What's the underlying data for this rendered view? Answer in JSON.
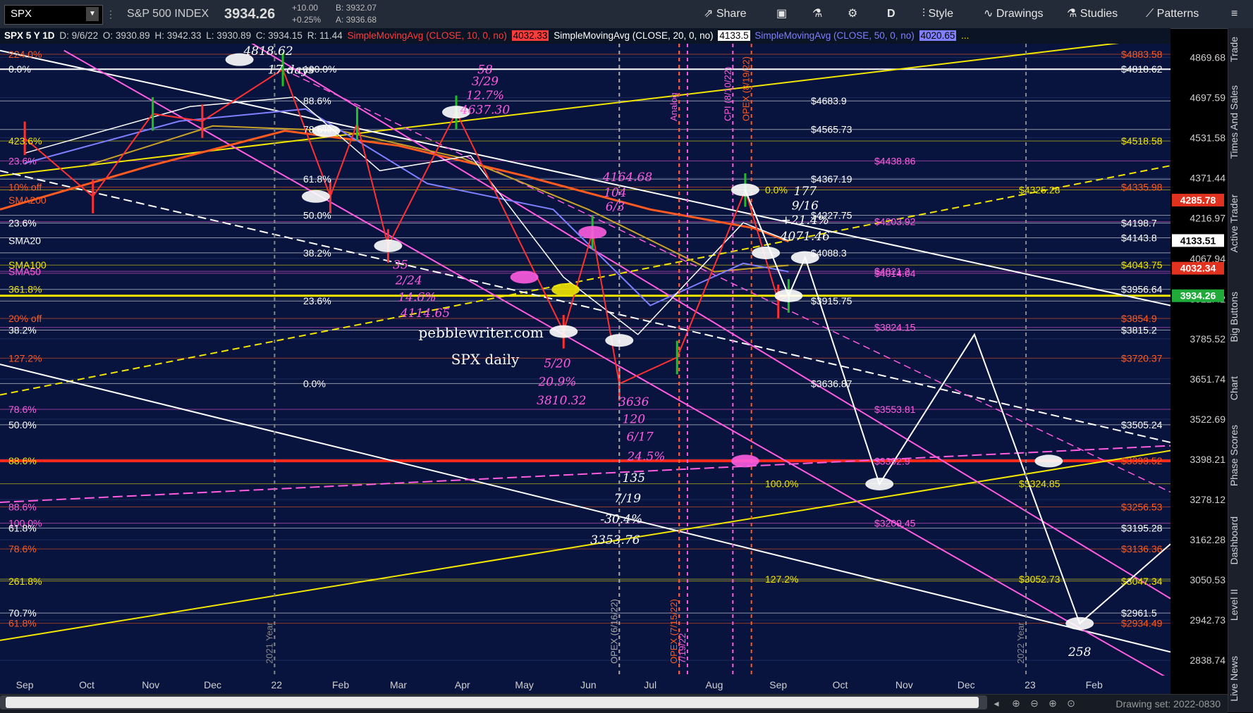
{
  "topbar": {
    "symbol": "SPX",
    "instrument_name": "S&P 500 INDEX",
    "last_price": "3934.26",
    "change": "+10.00",
    "change_pct": "+0.25%",
    "bid": "B: 3932.07",
    "ask": "A: 3936.68",
    "share_label": "Share",
    "period_label": "D",
    "style_label": "Style",
    "drawings_label": "Drawings",
    "studies_label": "Studies",
    "patterns_label": "Patterns"
  },
  "studybar": {
    "symbol_tf": "SPX 5 Y 1D",
    "date": "D: 9/6/22",
    "open": "O: 3930.89",
    "high": "H: 3942.33",
    "low": "L: 3930.89",
    "close": "C: 3934.15",
    "range": "R: 11.44",
    "sma10_label": "SimpleMovingAvg (CLOSE, 10, 0, no)",
    "sma10_value": "4032.33",
    "sma20_label": "SimpleMovingAvg (CLOSE, 20, 0, no)",
    "sma20_value": "4133.5",
    "sma50_label": "SimpleMovingAvg (CLOSE, 50, 0, no)",
    "sma50_value": "4020.65",
    "more": "..."
  },
  "colors": {
    "background": "#08143e",
    "sma10": "#ff3b3b",
    "sma20": "#ffffff",
    "sma50": "#7f7fff",
    "sma100": "#c9a227",
    "sma200": "#ff5a1f",
    "fib_yellow": "#f2e600",
    "fib_magenta": "#ff5ce0",
    "fib_white": "#ffffff",
    "up_candle": "#20c020",
    "down_candle": "#ff3030",
    "last_price_bg": "#1faa3a"
  },
  "right_rail": [
    "Trade",
    "Times And Sales",
    "Active Trader",
    "Big Buttons",
    "Chart",
    "Phase Scores",
    "Dashboard",
    "Level II",
    "Live News"
  ],
  "bottombar": {
    "drawing_set": "Drawing set: 2022-0830"
  },
  "chart_data": {
    "type": "line",
    "title": "SPX daily",
    "watermark": "pebblewriter.com",
    "xlabel": "",
    "ylabel": "",
    "ylim": [
      2800,
      4930
    ],
    "x_ticks": [
      "Sep",
      "Oct",
      "Nov",
      "Dec",
      "22",
      "Feb",
      "Mar",
      "Apr",
      "May",
      "Jun",
      "Jul",
      "Aug",
      "Sep",
      "Oct",
      "Nov",
      "Dec",
      "23",
      "Feb"
    ],
    "y_ticks": [
      4869.68,
      4697.59,
      4531.58,
      4371.44,
      4216.97,
      4067.94,
      3922.42,
      3785.52,
      3651.74,
      3522.69,
      3398.21,
      3278.12,
      3162.28,
      3050.53,
      2942.73,
      2838.74
    ],
    "price_series": {
      "name": "SPX",
      "x": [
        "2021-09-01",
        "2021-10-04",
        "2021-11-02",
        "2021-11-26",
        "2022-01-04",
        "2022-01-27",
        "2022-02-09",
        "2022-02-24",
        "2022-03-29",
        "2022-05-20",
        "2022-06-03",
        "2022-06-16",
        "2022-07-14",
        "2022-08-16",
        "2022-09-01",
        "2022-09-06"
      ],
      "y": [
        4530,
        4300,
        4630,
        4600,
        4818,
        4300,
        4590,
        4114,
        4637,
        3810,
        4164,
        3636,
        3723,
        4325,
        3915,
        3934
      ]
    },
    "moving_averages": [
      {
        "name": "SMA10",
        "value": 4032.33
      },
      {
        "name": "SMA20",
        "value": 4133.5
      },
      {
        "name": "SMA50",
        "value": 4020.65
      },
      {
        "name": "SMA100",
        "value": 4043.75
      },
      {
        "name": "SMA200",
        "value": 4285.78
      }
    ],
    "price_levels": [
      {
        "label": "$4883.58",
        "value": 4883.58,
        "color": "#ff5a1f"
      },
      {
        "label": "$4818.62",
        "value": 4818.62,
        "color": "#ffffff"
      },
      {
        "label": "$4683.9",
        "value": 4683.9,
        "color": "#ffffff"
      },
      {
        "label": "$4565.73",
        "value": 4565.73,
        "color": "#ffffff"
      },
      {
        "label": "$4518.58",
        "value": 4518.58,
        "color": "#f2e600"
      },
      {
        "label": "$4438.86",
        "value": 4438.86,
        "color": "#ff5ce0"
      },
      {
        "label": "$4367.19",
        "value": 4367.19,
        "color": "#ffffff"
      },
      {
        "label": "$4335.98",
        "value": 4335.98,
        "color": "#ff5a1f"
      },
      {
        "label": "$4325.28",
        "value": 4325.28,
        "color": "#f2e600"
      },
      {
        "label": "$4227.75",
        "value": 4227.75,
        "color": "#ffffff"
      },
      {
        "label": "$4203.92",
        "value": 4203.92,
        "color": "#ff5ce0"
      },
      {
        "label": "$4198.7",
        "value": 4198.7,
        "color": "#ffffff"
      },
      {
        "label": "$4143.8",
        "value": 4143.8,
        "color": "#ffffff"
      },
      {
        "label": "$4088.3",
        "value": 4088.3,
        "color": "#ffffff"
      },
      {
        "label": "$4043.75",
        "value": 4043.75,
        "color": "#f2e600"
      },
      {
        "label": "$4021.2",
        "value": 4021.2,
        "color": "#ff5ce0"
      },
      {
        "label": "$4014.04",
        "value": 4014.04,
        "color": "#ff5ce0"
      },
      {
        "label": "$3956.64",
        "value": 3956.64,
        "color": "#ffffff"
      },
      {
        "label": "$3915.75",
        "value": 3915.75,
        "color": "#ffffff"
      },
      {
        "label": "$3854.9",
        "value": 3854.9,
        "color": "#ff5a1f"
      },
      {
        "label": "$3824.15",
        "value": 3824.15,
        "color": "#ff5ce0"
      },
      {
        "label": "$3815.2",
        "value": 3815.2,
        "color": "#ffffff"
      },
      {
        "label": "$3720.37",
        "value": 3720.37,
        "color": "#ff5a1f"
      },
      {
        "label": "$3636.87",
        "value": 3636.87,
        "color": "#ffffff"
      },
      {
        "label": "$3553.81",
        "value": 3553.81,
        "color": "#ff5ce0"
      },
      {
        "label": "$3505.24",
        "value": 3505.24,
        "color": "#ffffff"
      },
      {
        "label": "$3393.52",
        "value": 3393.52,
        "color": "#ff5a1f"
      },
      {
        "label": "$3392.9",
        "value": 3392.9,
        "color": "#ff5ce0"
      },
      {
        "label": "$3324.85",
        "value": 3324.85,
        "color": "#f2e600"
      },
      {
        "label": "$3256.53",
        "value": 3256.53,
        "color": "#ff5a1f"
      },
      {
        "label": "$3209.45",
        "value": 3209.45,
        "color": "#ff5ce0"
      },
      {
        "label": "$3195.28",
        "value": 3195.28,
        "color": "#ffffff"
      },
      {
        "label": "$3136.36",
        "value": 3136.36,
        "color": "#ff5a1f"
      },
      {
        "label": "$3052.73",
        "value": 3052.73,
        "color": "#f2e600"
      },
      {
        "label": "$3047.34",
        "value": 3047.34,
        "color": "#f2e600"
      },
      {
        "label": "$2961.5",
        "value": 2961.5,
        "color": "#ffffff"
      },
      {
        "label": "$2934.49",
        "value": 2934.49,
        "color": "#ff5a1f"
      }
    ],
    "fib_labels_left": [
      {
        "label": "224.0%",
        "value": 4883.58,
        "color": "#ff5a1f"
      },
      {
        "label": "0.0%",
        "value": 4818.62,
        "color": "#ffffff"
      },
      {
        "label": "423.6%",
        "value": 4518.58,
        "color": "#f2e600"
      },
      {
        "label": "23.6%",
        "value": 4438.86,
        "color": "#ff5ce0"
      },
      {
        "label": "10% off",
        "value": 4335.98,
        "color": "#ff5a1f"
      },
      {
        "label": "SMA200",
        "value": 4285.78,
        "color": "#ff5a1f"
      },
      {
        "label": "23.6%",
        "value": 4198.7,
        "color": "#ffffff"
      },
      {
        "label": "SMA20",
        "value": 4133.5,
        "color": "#ffffff"
      },
      {
        "label": "SMA100",
        "value": 4043.75,
        "color": "#f2e600"
      },
      {
        "label": "SMA50",
        "value": 4020.65,
        "color": "#ff5ce0"
      },
      {
        "label": "361.8%",
        "value": 3956.64,
        "color": "#f2e600"
      },
      {
        "label": "20% off",
        "value": 3854.9,
        "color": "#ff5a1f"
      },
      {
        "label": "38.2%",
        "value": 3815.2,
        "color": "#ffffff"
      },
      {
        "label": "127.2%",
        "value": 3720.37,
        "color": "#ff5a1f"
      },
      {
        "label": "78.6%",
        "value": 3553.81,
        "color": "#ff5ce0"
      },
      {
        "label": "50.0%",
        "value": 3505.24,
        "color": "#ffffff"
      },
      {
        "label": "88.6%",
        "value": 3393.52,
        "color": "#f2e600"
      },
      {
        "label": "88.6%",
        "value": 3256.53,
        "color": "#ff5ce0"
      },
      {
        "label": "100.0%",
        "value": 3209.45,
        "color": "#ff5ce0"
      },
      {
        "label": "61.8%",
        "value": 3195.28,
        "color": "#ffffff"
      },
      {
        "label": "78.6%",
        "value": 3136.36,
        "color": "#ff5a1f"
      },
      {
        "label": "261.8%",
        "value": 3047.34,
        "color": "#f2e600"
      },
      {
        "label": "70.7%",
        "value": 2961.5,
        "color": "#ffffff"
      },
      {
        "label": "61.8%",
        "value": 2934.49,
        "color": "#ff5a1f"
      }
    ],
    "fib_labels_mid": [
      {
        "label": "100.0%",
        "value": 4818.62
      },
      {
        "label": "88.6%",
        "value": 4683.9
      },
      {
        "label": "78.6%",
        "value": 4565.73
      },
      {
        "label": "61.8%",
        "value": 4367.19
      },
      {
        "label": "50.0%",
        "value": 4227.75
      },
      {
        "label": "38.2%",
        "value": 4088.3
      },
      {
        "label": "23.6%",
        "value": 3915.75
      },
      {
        "label": "0.0%",
        "value": 3636.87
      }
    ],
    "fib_labels_right": [
      {
        "label": "0.0%",
        "value": 4325.28
      },
      {
        "label": "100.0%",
        "value": 3324.85
      },
      {
        "label": "127.2%",
        "value": 3052.73
      }
    ],
    "annotations": [
      {
        "text": "4818.62",
        "x": "2021-12-28",
        "y": 4880,
        "color": "#ffffff"
      },
      {
        "text": "17 days",
        "x": "2022-01-08",
        "y": 4800,
        "color": "#ffffff"
      },
      {
        "text": "58",
        "x": "2022-04-12",
        "y": 4800,
        "color": "#ff5ce0"
      },
      {
        "text": "3/29",
        "x": "2022-04-12",
        "y": 4750,
        "color": "#ff5ce0"
      },
      {
        "text": "12.7%",
        "x": "2022-04-12",
        "y": 4690,
        "color": "#ff5ce0"
      },
      {
        "text": "4637.30",
        "x": "2022-04-12",
        "y": 4630,
        "color": "#ff5ce0"
      },
      {
        "text": "4164.68",
        "x": "2022-06-20",
        "y": 4360,
        "color": "#ff5ce0"
      },
      {
        "text": "104",
        "x": "2022-06-14",
        "y": 4300,
        "color": "#ff5ce0"
      },
      {
        "text": "6/3",
        "x": "2022-06-14",
        "y": 4245,
        "color": "#ff5ce0"
      },
      {
        "text": "35",
        "x": "2022-03-02",
        "y": 4030,
        "color": "#ff5ce0"
      },
      {
        "text": "2/24",
        "x": "2022-03-06",
        "y": 3975,
        "color": "#ff5ce0"
      },
      {
        "text": "14.6%",
        "x": "2022-03-10",
        "y": 3915,
        "color": "#ff5ce0"
      },
      {
        "text": "4114.65",
        "x": "2022-03-14",
        "y": 3860,
        "color": "#ff5ce0"
      },
      {
        "text": "5/20",
        "x": "2022-05-17",
        "y": 3690,
        "color": "#ff5ce0"
      },
      {
        "text": "20.9%",
        "x": "2022-05-17",
        "y": 3630,
        "color": "#ff5ce0"
      },
      {
        "text": "3810.32",
        "x": "2022-05-19",
        "y": 3570,
        "color": "#ff5ce0"
      },
      {
        "text": "3636",
        "x": "2022-06-23",
        "y": 3565,
        "color": "#ff5ce0"
      },
      {
        "text": "120",
        "x": "2022-06-23",
        "y": 3510,
        "color": "#ff5ce0"
      },
      {
        "text": "6/17",
        "x": "2022-06-26",
        "y": 3455,
        "color": "#ff5ce0"
      },
      {
        "text": "24.5%",
        "x": "2022-06-29",
        "y": 3395,
        "color": "#ff5ce0"
      },
      {
        "text": "135",
        "x": "2022-06-23",
        "y": 3330,
        "color": "#ffffff"
      },
      {
        "text": "7/19",
        "x": "2022-06-20",
        "y": 3270,
        "color": "#ffffff"
      },
      {
        "text": "-30.4%",
        "x": "2022-06-17",
        "y": 3210,
        "color": "#ffffff"
      },
      {
        "text": "3353.76",
        "x": "2022-06-14",
        "y": 3150,
        "color": "#ffffff"
      },
      {
        "text": "177",
        "x": "2022-09-14",
        "y": 4305,
        "color": "#ffffff"
      },
      {
        "text": "9/16",
        "x": "2022-09-14",
        "y": 4250,
        "color": "#ffffff"
      },
      {
        "text": "+21.4%",
        "x": "2022-09-14",
        "y": 4195,
        "color": "#ffffff"
      },
      {
        "text": "4071.46",
        "x": "2022-09-14",
        "y": 4135,
        "color": "#ffffff"
      },
      {
        "text": "258",
        "x": "2023-01-25",
        "y": 2850,
        "color": "#ffffff"
      }
    ],
    "vertical_markers": [
      {
        "label": "2021 Year",
        "x": "2021-12-31",
        "color": "#888888"
      },
      {
        "label": "OPEX (6/16/22)",
        "x": "2022-06-16",
        "color": "#aaaaaa"
      },
      {
        "label": "Analog",
        "x": "2022-07-15",
        "color": "#ff5ce0"
      },
      {
        "label": "OPEX (7/15/22)",
        "x": "2022-07-15",
        "color": "#ff5a1f"
      },
      {
        "label": "7/19/22",
        "x": "2022-07-19",
        "color": "#ff5ce0"
      },
      {
        "label": "CPI (8/10/22)",
        "x": "2022-08-10",
        "color": "#ff5ce0"
      },
      {
        "label": "OPEX (8/19/22)",
        "x": "2022-08-19",
        "color": "#ff5a1f"
      },
      {
        "label": "2022 Year",
        "x": "2022-12-30",
        "color": "#888888"
      }
    ],
    "axis_badges": [
      {
        "label": "4285.78",
        "value": 4285.78,
        "bg": "#e0321e"
      },
      {
        "label": "4133.51",
        "value": 4133.51,
        "bg": "#ffffff"
      },
      {
        "label": "4032.34",
        "value": 4032.34,
        "bg": "#e0321e"
      },
      {
        "label": "3934.26",
        "value": 3934.26,
        "bg": "#1faa3a"
      }
    ],
    "grid": true,
    "legend": "top-left"
  }
}
